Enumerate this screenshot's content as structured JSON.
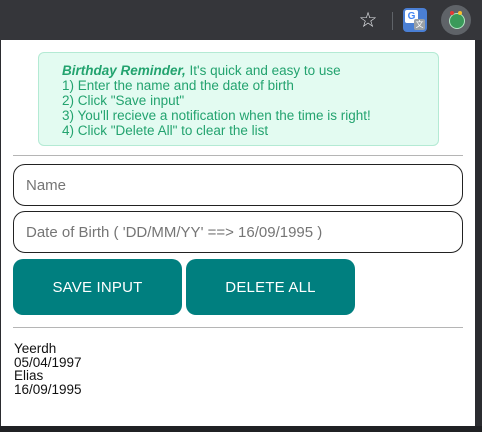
{
  "browser": {
    "star_glyph": "☆",
    "extensions": [
      {
        "icon": "google-translate-icon",
        "glyph_main": "G",
        "glyph_sub": "文"
      },
      {
        "icon": "birthday-reminder-extension-icon"
      }
    ]
  },
  "info": {
    "title": "Birthday Reminder,",
    "intro": " It's quick and easy to use",
    "steps": [
      "1) Enter the name and the date of birth",
      "2) Click \"Save input\"",
      "3) You'll recieve a notification when the time is right!",
      "4) Click \"Delete All\" to clear the list"
    ]
  },
  "form": {
    "name_placeholder": "Name",
    "name_value": "",
    "dob_placeholder": "Date of Birth ( 'DD/MM/YY' ==> 16/09/1995 )",
    "dob_value": ""
  },
  "buttons": {
    "save_label": "SAVE INPUT",
    "delete_label": "DELETE ALL"
  },
  "entries": [
    {
      "name": "Yeerdh",
      "dob": "05/04/1997"
    },
    {
      "name": "Elias",
      "dob": "16/09/1995"
    }
  ],
  "colors": {
    "accent": "#007f7f",
    "info_bg": "#e3fbf1",
    "info_text": "#23a36f"
  }
}
